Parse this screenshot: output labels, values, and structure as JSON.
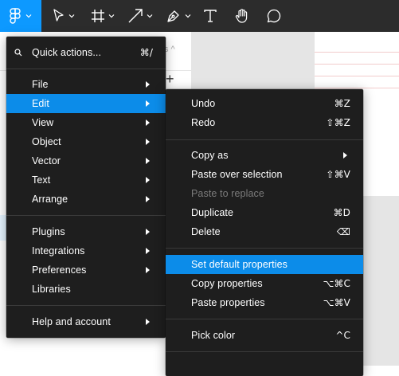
{
  "toolbar": {
    "tools": [
      {
        "icon": "figma-logo-icon",
        "has_menu": true,
        "active": true
      },
      {
        "icon": "move-cursor-icon",
        "has_menu": true
      },
      {
        "icon": "frame-icon",
        "has_menu": true
      },
      {
        "icon": "arrow-line-icon",
        "has_menu": true
      },
      {
        "icon": "pen-icon",
        "has_menu": true
      },
      {
        "icon": "text-icon",
        "has_menu": false
      },
      {
        "icon": "hand-icon",
        "has_menu": false
      },
      {
        "icon": "comment-icon",
        "has_menu": false
      }
    ],
    "accent": "#0d99ff"
  },
  "main_menu": {
    "quick_actions": {
      "label": "Quick actions...",
      "shortcut": "⌘/"
    },
    "items": [
      {
        "label": "File",
        "submenu": true
      },
      {
        "label": "Edit",
        "submenu": true,
        "active": true
      },
      {
        "label": "View",
        "submenu": true
      },
      {
        "label": "Object",
        "submenu": true
      },
      {
        "label": "Vector",
        "submenu": true
      },
      {
        "label": "Text",
        "submenu": true
      },
      {
        "label": "Arrange",
        "submenu": true
      },
      {
        "label": "Plugins",
        "submenu": true
      },
      {
        "label": "Integrations",
        "submenu": true
      },
      {
        "label": "Preferences",
        "submenu": true
      },
      {
        "label": "Libraries",
        "submenu": false
      },
      {
        "label": "Help and account",
        "submenu": true
      }
    ]
  },
  "edit_menu": {
    "items": [
      {
        "label": "Undo",
        "shortcut": "⌘Z"
      },
      {
        "label": "Redo",
        "shortcut": "⇧⌘Z"
      },
      {
        "label": "Copy as",
        "submenu": true
      },
      {
        "label": "Paste over selection",
        "shortcut": "⇧⌘V"
      },
      {
        "label": "Paste to replace",
        "disabled": true
      },
      {
        "label": "Duplicate",
        "shortcut": "⌘D"
      },
      {
        "label": "Delete",
        "shortcut": "⌫"
      },
      {
        "label": "Set default properties",
        "active": true
      },
      {
        "label": "Copy properties",
        "shortcut": "⌥⌘C"
      },
      {
        "label": "Paste properties",
        "shortcut": "⌥⌘V"
      },
      {
        "label": "Pick color",
        "shortcut": "^C"
      }
    ]
  },
  "colors": {
    "menu_bg": "#1e1e1e",
    "highlight": "#0c8ce9",
    "toolbar_bg": "#2c2c2c"
  }
}
